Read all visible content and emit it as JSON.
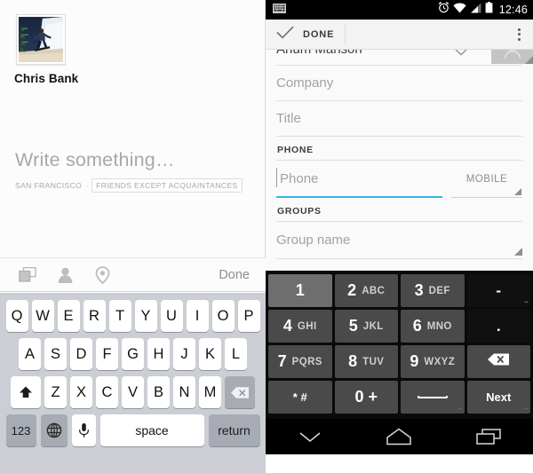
{
  "ios": {
    "profile": {
      "name": "Chris Bank",
      "avatar_alt": "snowboarder-photo"
    },
    "compose": {
      "placeholder": "Write something…",
      "location": "SAN FRANCISCO",
      "separator": "·",
      "audience": "FRIENDS EXCEPT ACQUAINTANCES"
    },
    "toolbar": {
      "photo_icon": "photos-icon",
      "person_icon": "person-tag-icon",
      "location_icon": "location-pin-icon",
      "done_label": "Done"
    },
    "keyboard": {
      "row1": [
        "Q",
        "W",
        "E",
        "R",
        "T",
        "Y",
        "U",
        "I",
        "O",
        "P"
      ],
      "row2": [
        "A",
        "S",
        "D",
        "F",
        "G",
        "H",
        "J",
        "K",
        "L"
      ],
      "row3": [
        "Z",
        "X",
        "C",
        "V",
        "B",
        "N",
        "M"
      ],
      "shift_icon": "shift-up-arrow-icon",
      "backspace_icon": "backspace-icon",
      "numbers_label": "123",
      "globe_icon": "globe-icon",
      "mic_icon": "microphone-icon",
      "space_label": "space",
      "return_label": "return"
    }
  },
  "android": {
    "status_bar": {
      "keyboard_icon": "keyboard-indicator-icon",
      "alarm_icon": "alarm-clock-icon",
      "wifi_icon": "wifi-icon",
      "signal_icon": "cell-signal-icon",
      "battery_icon": "battery-icon",
      "time": "12:46"
    },
    "action_bar": {
      "check_icon": "checkmark-icon",
      "done_label": "DONE",
      "overflow_icon": "overflow-menu-icon"
    },
    "form": {
      "name_value": "Anum Manson",
      "name_expand_icon": "chevron-down-icon",
      "photo_placeholder_icon": "person-photo-icon",
      "company_placeholder": "Company",
      "title_placeholder": "Title",
      "phone_section": "PHONE",
      "phone_placeholder": "Phone",
      "phone_type": "MOBILE",
      "groups_section": "GROUPS",
      "group_placeholder": "Group name"
    },
    "keypad": {
      "rows": [
        [
          {
            "num": "1",
            "alpha": "",
            "state": "lit"
          },
          {
            "num": "2",
            "alpha": "ABC",
            "state": "normal"
          },
          {
            "num": "3",
            "alpha": "DEF",
            "state": "normal"
          },
          {
            "num": "-",
            "alpha": "",
            "state": "plain"
          }
        ],
        [
          {
            "num": "4",
            "alpha": "GHI",
            "state": "normal"
          },
          {
            "num": "5",
            "alpha": "JKL",
            "state": "normal"
          },
          {
            "num": "6",
            "alpha": "MNO",
            "state": "normal"
          },
          {
            "num": ".",
            "alpha": "",
            "state": "plain"
          }
        ],
        [
          {
            "num": "7",
            "alpha": "PQRS",
            "state": "normal"
          },
          {
            "num": "8",
            "alpha": "TUV",
            "state": "normal"
          },
          {
            "num": "9",
            "alpha": "WXYZ",
            "state": "normal"
          },
          {
            "num": "",
            "alpha": "",
            "state": "normal",
            "icon": "backspace-icon"
          }
        ],
        [
          {
            "num": "* #",
            "alpha": "",
            "state": "normal"
          },
          {
            "num": "0 +",
            "alpha": "",
            "state": "normal"
          },
          {
            "num": "",
            "alpha": "",
            "state": "normal",
            "icon": "spacebar-icon"
          },
          {
            "num": "",
            "alpha": "",
            "state": "normal",
            "label": "Next"
          }
        ]
      ]
    },
    "nav_bar": {
      "back_icon": "hide-keyboard-chevron-icon",
      "home_icon": "home-icon",
      "recents_icon": "recent-apps-icon"
    }
  },
  "colors": {
    "ios_keyboard_bg": "#cbced4",
    "android_accent": "#33b5e5",
    "android_keypad_bg": "#0a0a0a",
    "android_key": "#4a4a4a"
  }
}
